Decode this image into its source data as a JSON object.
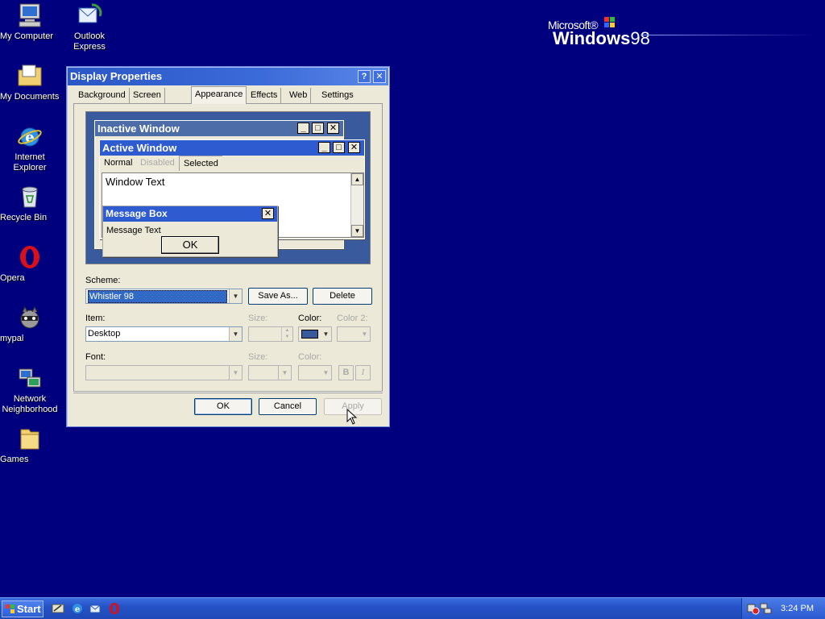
{
  "desktop": {
    "icons": [
      {
        "label": "My Computer",
        "icon": "my-computer-icon"
      },
      {
        "label": "Outlook Express",
        "icon": "outlook-express-icon"
      },
      {
        "label": "My Documents",
        "icon": "my-documents-icon"
      },
      {
        "label": "Internet Explorer",
        "icon": "internet-explorer-icon"
      },
      {
        "label": "Recycle Bin",
        "icon": "recycle-bin-icon"
      },
      {
        "label": "Opera",
        "icon": "opera-icon"
      },
      {
        "label": "mypal",
        "icon": "mypal-icon"
      },
      {
        "label": "Network Neighborhood",
        "icon": "network-neighborhood-icon"
      },
      {
        "label": "Games",
        "icon": "games-folder-icon"
      }
    ],
    "logo": {
      "brand": "Microsoft®",
      "product": "Windows",
      "version": "98"
    }
  },
  "dialog": {
    "title": "Display Properties",
    "help_button": "?",
    "close_button": "✕",
    "tabs": [
      "Background",
      "Screen Saver",
      "Appearance",
      "Effects",
      "Web",
      "Settings"
    ],
    "active_tab": "Appearance",
    "preview": {
      "inactive_title": "Inactive Window",
      "active_title": "Active Window",
      "menu": {
        "normal": "Normal",
        "disabled": "Disabled",
        "selected": "Selected"
      },
      "window_text": "Window Text",
      "message_box": {
        "title": "Message Box",
        "text": "Message Text",
        "ok": "OK"
      }
    },
    "scheme": {
      "label": "Scheme:",
      "value": "Whistler 98",
      "save_as": "Save As...",
      "delete": "Delete"
    },
    "item": {
      "label": "Item:",
      "value": "Desktop",
      "size_label": "Size:",
      "color_label": "Color:",
      "color2_label": "Color 2:",
      "color_value": "#3a5a9e"
    },
    "font": {
      "label": "Font:",
      "size_label": "Size:",
      "color_label": "Color:",
      "bold": "B",
      "italic": "I"
    },
    "buttons": {
      "ok": "OK",
      "cancel": "Cancel",
      "apply": "Apply"
    }
  },
  "taskbar": {
    "start_label": "Start",
    "quick_launch": [
      "show-desktop-icon",
      "internet-explorer-icon",
      "outlook-express-icon",
      "opera-icon"
    ],
    "clock": "3:24 PM"
  },
  "colors": {
    "desktop": "#00007f",
    "title_active": "#2b57c6",
    "taskbar": "#2553c7",
    "dialog_face": "#ece9d8"
  }
}
